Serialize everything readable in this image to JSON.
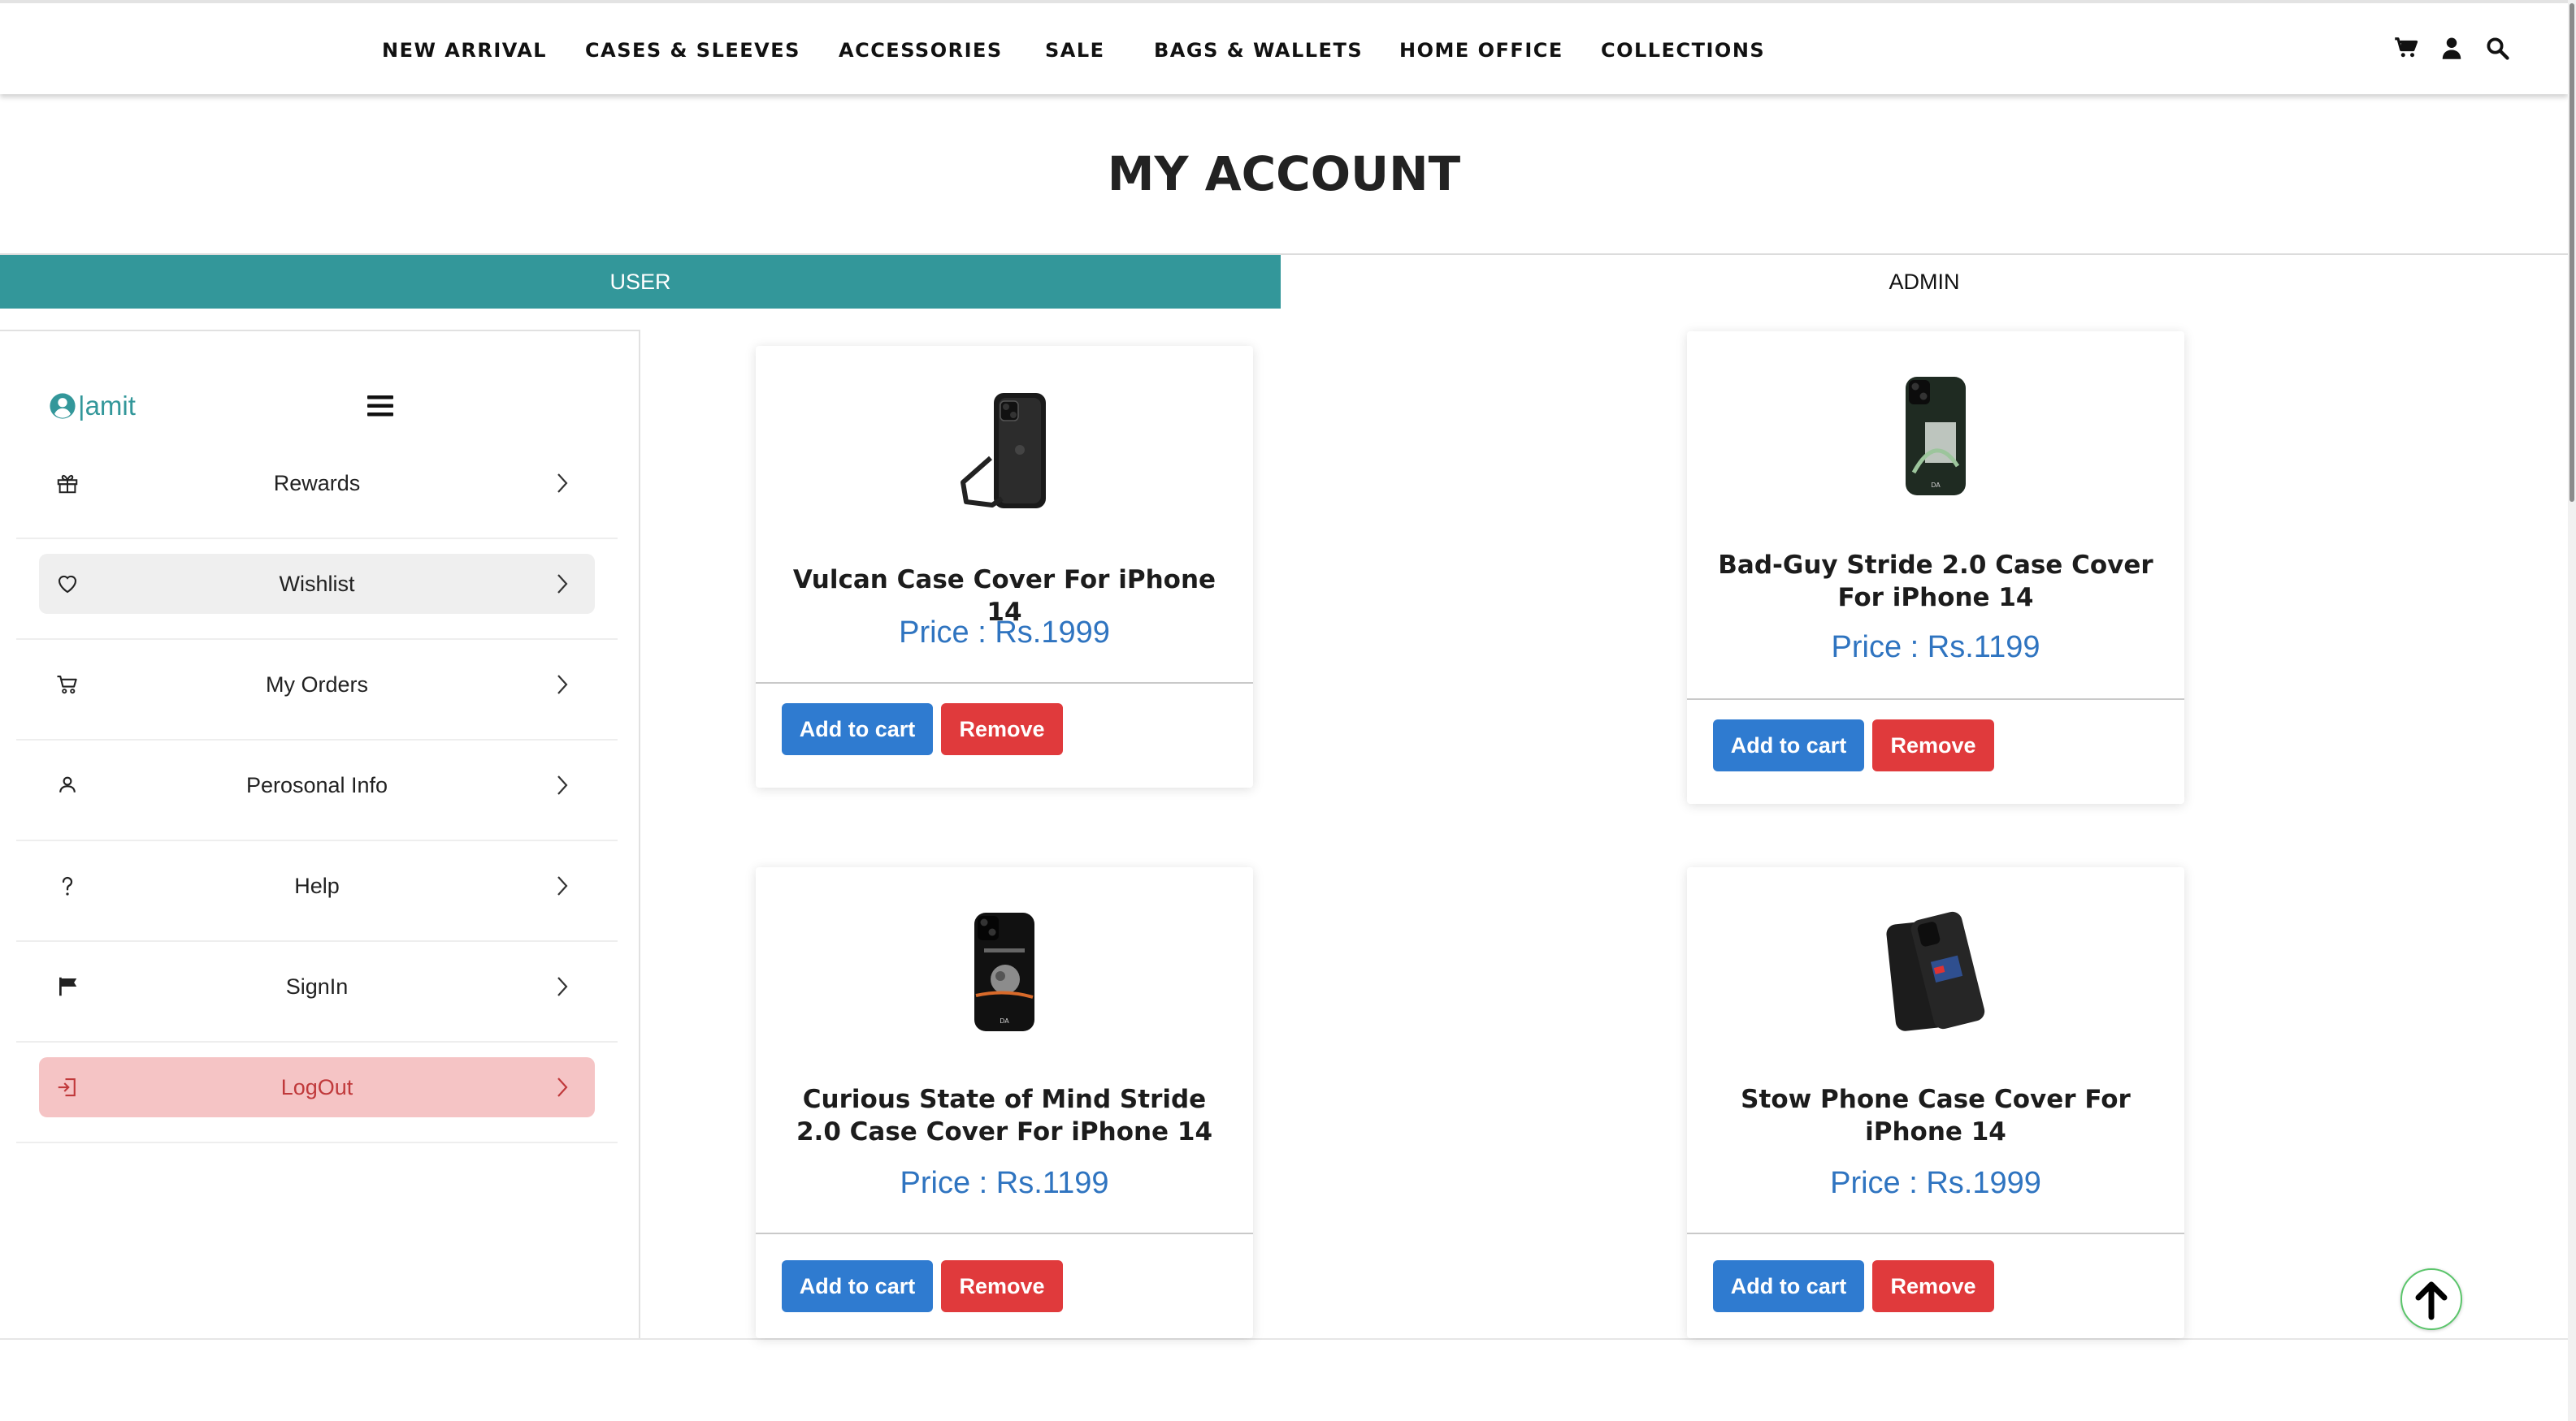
{
  "nav": {
    "items": [
      "NEW ARRIVAL",
      "CASES & SLEEVES",
      "ACCESSORIES",
      "SALE",
      "BAGS & WALLETS",
      "HOME OFFICE",
      "COLLECTIONS"
    ],
    "icons": [
      "cart-icon",
      "user-icon",
      "search-icon"
    ]
  },
  "page": {
    "title": "MY ACCOUNT"
  },
  "tabs": {
    "user": "USER",
    "admin": "ADMIN",
    "active": "USER"
  },
  "sidebar": {
    "username": "|amit",
    "items": [
      {
        "label": "Rewards",
        "icon": "gift-icon"
      },
      {
        "label": "Wishlist",
        "icon": "heart-icon",
        "active": true
      },
      {
        "label": "My Orders",
        "icon": "cart-icon"
      },
      {
        "label": "Perosonal Info",
        "icon": "person-icon"
      },
      {
        "label": "Help",
        "icon": "question-icon"
      },
      {
        "label": "SignIn",
        "icon": "flag-icon"
      },
      {
        "label": "LogOut",
        "icon": "logout-icon"
      }
    ]
  },
  "wishlist": [
    {
      "name": "Vulcan Case Cover For iPhone 14",
      "price": "Price : Rs.1999",
      "add_label": "Add to cart",
      "remove_label": "Remove"
    },
    {
      "name": "Bad-Guy Stride 2.0 Case Cover For iPhone 14",
      "price": "Price : Rs.1199",
      "add_label": "Add to cart",
      "remove_label": "Remove"
    },
    {
      "name": "Curious State of Mind Stride 2.0 Case Cover For iPhone 14",
      "price": "Price : Rs.1199",
      "add_label": "Add to cart",
      "remove_label": "Remove"
    },
    {
      "name": "Stow Phone Case Cover For iPhone 14",
      "price": "Price : Rs.1999",
      "add_label": "Add to cart",
      "remove_label": "Remove"
    }
  ],
  "colors": {
    "accent": "#33979a",
    "price": "#2f74c0",
    "add_button": "#2f7bd0",
    "remove_button": "#e03a3c",
    "logout_bg": "#f5c4c5"
  }
}
